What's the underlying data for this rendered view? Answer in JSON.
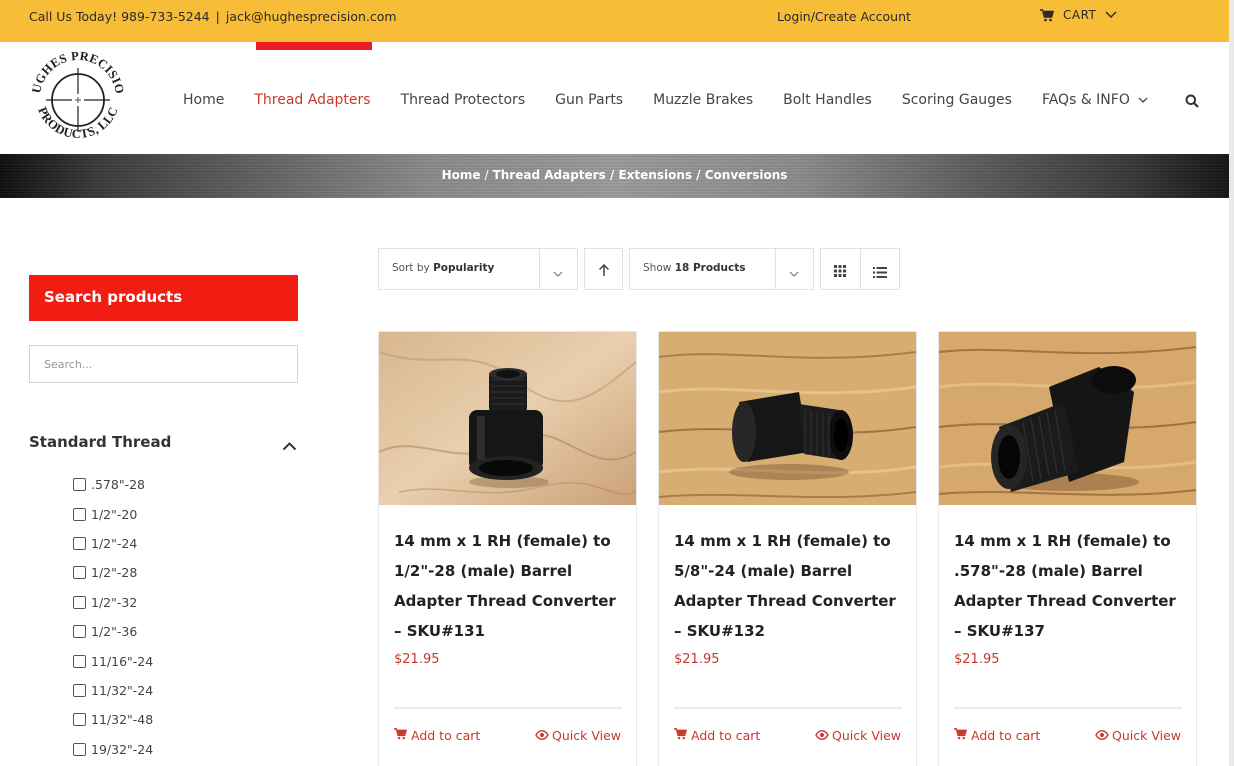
{
  "topbar": {
    "phone": "Call Us Today! 989-733-5244",
    "separator": "|",
    "email": "jack@hughesprecision.com",
    "login": "Login/Create Account",
    "cart": "CART"
  },
  "brand": {
    "logo_line1": "HUGHES PRECISION",
    "logo_line2": "PRODUCTS, LLC"
  },
  "nav": {
    "items": [
      "Home",
      "Thread Adapters",
      "Thread Protectors",
      "Gun Parts",
      "Muzzle Brakes",
      "Bolt Handles",
      "Scoring Gauges",
      "FAQs & INFO"
    ],
    "active": "Thread Adapters"
  },
  "breadcrumb": [
    "Home",
    "Thread Adapters / Extensions / Conversions"
  ],
  "sidebar": {
    "search_title": "Search products",
    "search_placeholder": "Search...",
    "filter_title": "Standard Thread",
    "threads": [
      ".578\"-28",
      "1/2\"-20",
      "1/2\"-24",
      "1/2\"-28",
      "1/2\"-32",
      "1/2\"-36",
      "11/16\"-24",
      "11/32\"-24",
      "11/32\"-48",
      "19/32\"-24"
    ]
  },
  "toolbar": {
    "sort_prefix": "Sort by",
    "sort_value": "Popularity",
    "show_prefix": "Show",
    "show_value": "18 Products"
  },
  "products": [
    {
      "title": "14 mm x 1 RH (female) to 1/2\"-28 (male) Barrel Adapter Thread Converter – SKU#131",
      "price": "$21.95",
      "add_to_cart": "Add to cart",
      "quick_view": "Quick View"
    },
    {
      "title": "14 mm x 1 RH (female) to 5/8\"-24 (male) Barrel Adapter Thread Converter – SKU#132",
      "price": "$21.95",
      "add_to_cart": "Add to cart",
      "quick_view": "Quick View"
    },
    {
      "title": "14 mm x 1 RH (female) to .578\"-28 (male) Barrel Adapter Thread Converter – SKU#137",
      "price": "$21.95",
      "add_to_cart": "Add to cart",
      "quick_view": "Quick View"
    }
  ],
  "colors": {
    "topbar": "#f7bd37",
    "accent_red": "#ec1b23",
    "search_title_bg": "#f11d12",
    "price_red": "#c9382c"
  },
  "icons": {
    "cart": "cart-icon",
    "search": "search-icon",
    "grid": "grid-view-icon",
    "list": "list-view-icon",
    "sort_direction": "sort-direction-icon",
    "quick_view": "eye-icon"
  }
}
